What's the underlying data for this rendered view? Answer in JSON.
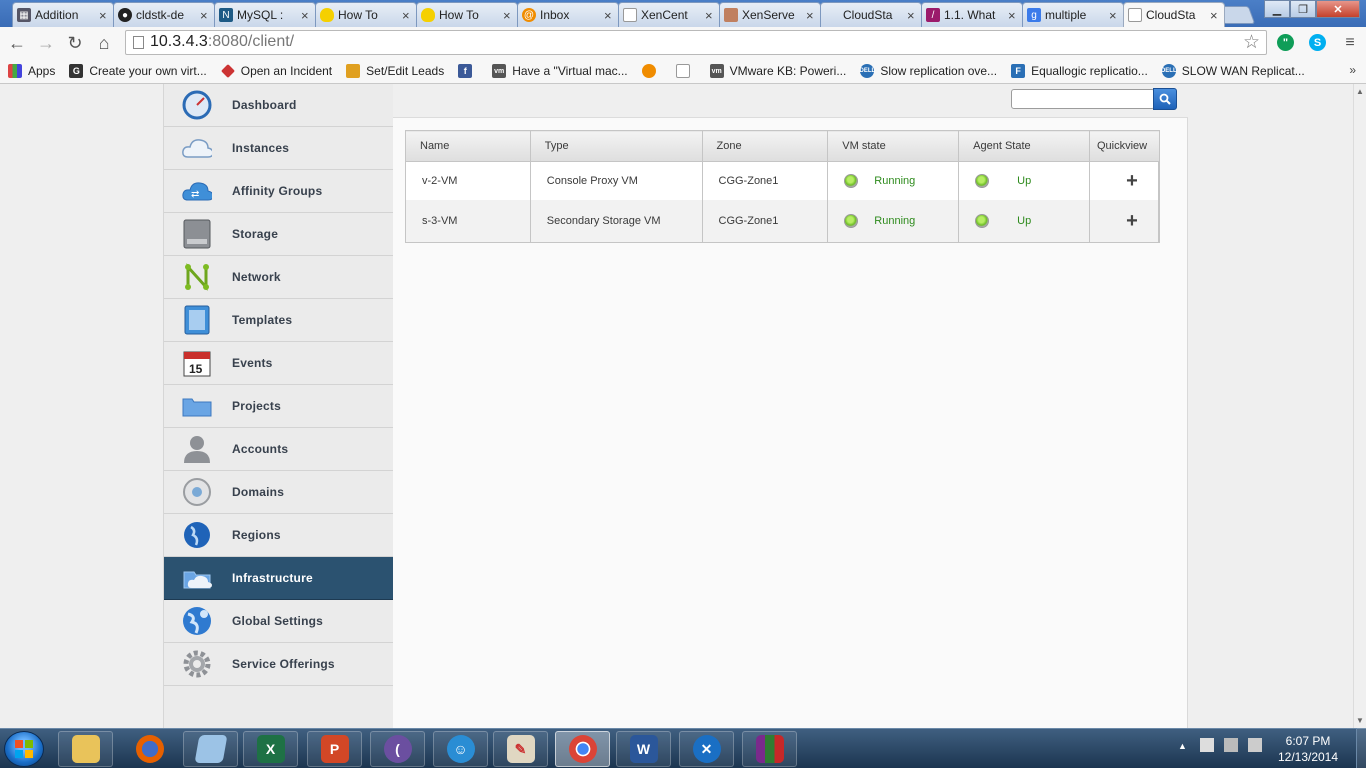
{
  "browser": {
    "tabs": [
      {
        "title": "Addition",
        "icon": "ledger-icon"
      },
      {
        "title": "cldstk-de",
        "icon": "github-icon"
      },
      {
        "title": "MySQL :",
        "icon": "mysql-icon"
      },
      {
        "title": "How To",
        "icon": "lightbulb-icon"
      },
      {
        "title": "How To",
        "icon": "lightbulb-icon"
      },
      {
        "title": "Inbox",
        "icon": "mail-icon"
      },
      {
        "title": "XenCent",
        "icon": "document-icon"
      },
      {
        "title": "XenServe",
        "icon": "person-icon"
      },
      {
        "title": "CloudSta",
        "icon": "blank-icon"
      },
      {
        "title": "1.1. What",
        "icon": "feather-icon"
      },
      {
        "title": "multiple",
        "icon": "google-icon"
      },
      {
        "title": "CloudSta",
        "icon": "document-icon"
      }
    ],
    "url_host": "10.3.4.3",
    "url_path": ":8080/client/",
    "bookmarks": [
      {
        "label": "Apps",
        "icon": "apps-grid-icon",
        "color": "#d44"
      },
      {
        "label": "Create your own virt...",
        "icon": "g-icon",
        "color": "#333"
      },
      {
        "label": "Open an Incident",
        "icon": "incident-icon",
        "color": "#c33"
      },
      {
        "label": "Set/Edit Leads",
        "icon": "box-icon",
        "color": "#e0a020"
      },
      {
        "label": "",
        "icon": "facebook-icon",
        "color": "#3b5998"
      },
      {
        "label": "Have a \"Virtual mac...",
        "icon": "vm-icon",
        "color": "#555"
      },
      {
        "label": "",
        "icon": "orange-circle-icon",
        "color": "#f08c00"
      },
      {
        "label": "",
        "icon": "document-icon",
        "color": "#999"
      },
      {
        "label": "VMware KB: Poweri...",
        "icon": "vm-icon",
        "color": "#555"
      },
      {
        "label": "Slow replication ove...",
        "icon": "dell-icon",
        "color": "#2a6fb5"
      },
      {
        "label": "Equallogic replicatio...",
        "icon": "equallogic-icon",
        "color": "#2a6fb5"
      },
      {
        "label": "SLOW WAN Replicat...",
        "icon": "dell-icon",
        "color": "#2a6fb5"
      }
    ],
    "bookmarks_more": "»"
  },
  "sidebar": {
    "items": [
      {
        "label": "Dashboard",
        "icon": "dashboard-gauge-icon"
      },
      {
        "label": "Instances",
        "icon": "cloud-icon"
      },
      {
        "label": "Affinity Groups",
        "icon": "affinity-cloud-icon"
      },
      {
        "label": "Storage",
        "icon": "storage-drive-icon"
      },
      {
        "label": "Network",
        "icon": "network-icon"
      },
      {
        "label": "Templates",
        "icon": "template-icon"
      },
      {
        "label": "Events",
        "icon": "calendar-icon"
      },
      {
        "label": "Projects",
        "icon": "folder-icon"
      },
      {
        "label": "Accounts",
        "icon": "user-icon"
      },
      {
        "label": "Domains",
        "icon": "domain-icon"
      },
      {
        "label": "Regions",
        "icon": "globe-icon"
      },
      {
        "label": "Infrastructure",
        "icon": "infrastructure-icon"
      },
      {
        "label": "Global Settings",
        "icon": "globe-settings-icon"
      },
      {
        "label": "Service Offerings",
        "icon": "gear-icon"
      }
    ],
    "active_index": 11,
    "calendar_day": "15"
  },
  "search": {
    "placeholder": "",
    "value": ""
  },
  "table": {
    "columns": [
      "Name",
      "Type",
      "Zone",
      "VM state",
      "Agent State",
      "Quickview"
    ],
    "rows": [
      {
        "name": "v-2-VM",
        "type": "Console Proxy VM",
        "zone": "CGG-Zone1",
        "vm_state": "Running",
        "agent_state": "Up",
        "quickview": "+"
      },
      {
        "name": "s-3-VM",
        "type": "Secondary Storage VM",
        "zone": "CGG-Zone1",
        "vm_state": "Running",
        "agent_state": "Up",
        "quickview": "+"
      }
    ]
  },
  "taskbar": {
    "apps": [
      "explorer-icon",
      "firefox-icon",
      "notepad-icon",
      "excel-icon",
      "powerpoint-icon",
      "eclipse-icon",
      "lync-icon",
      "paint-icon",
      "chrome-icon",
      "word-icon",
      "xenapp-icon",
      "winrar-icon"
    ],
    "time": "6:07 PM",
    "date": "12/13/2014"
  },
  "colors": {
    "sidebar_active": "#2b5270",
    "state_green": "#2e8b1d",
    "search_button": "#1f62b8"
  }
}
